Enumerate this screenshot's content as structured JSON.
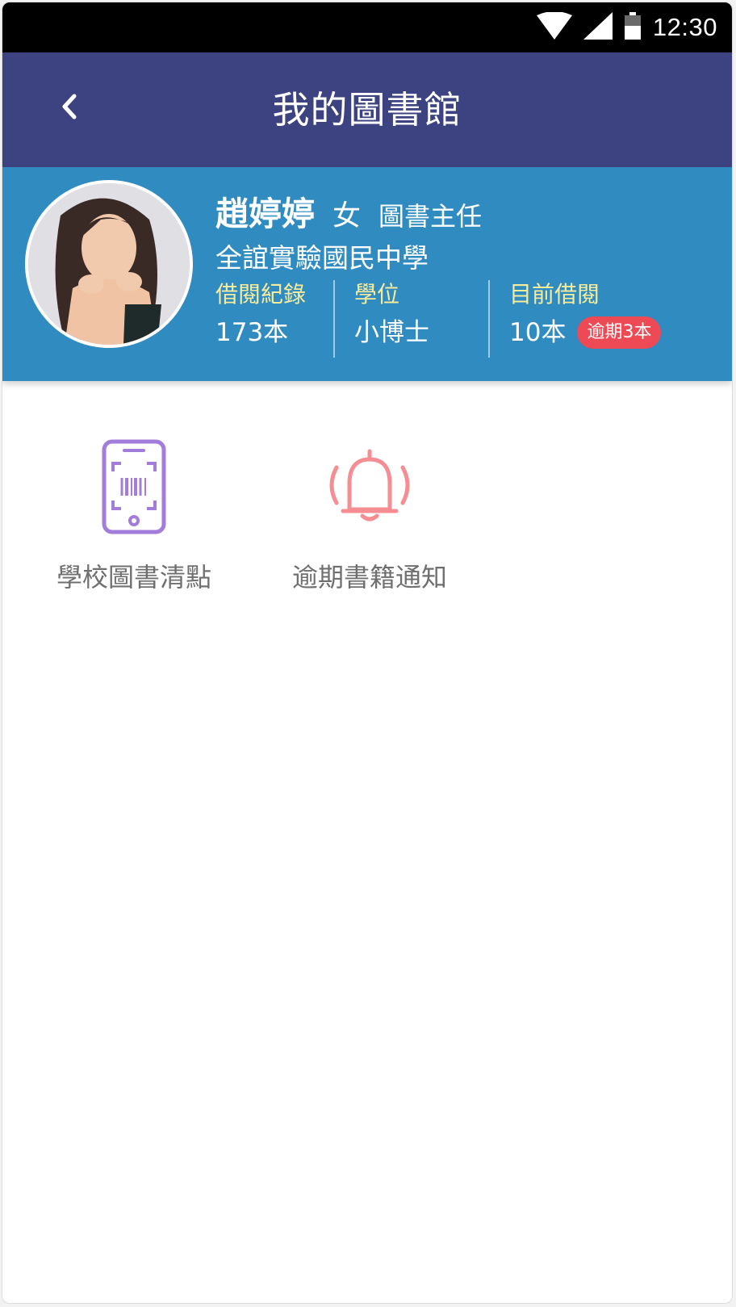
{
  "status_bar": {
    "time": "12:30",
    "icons": [
      "wifi-icon",
      "signal-icon",
      "battery-icon"
    ]
  },
  "header": {
    "title": "我的圖書館",
    "back_icon": "chevron-left-icon"
  },
  "profile": {
    "name": "趙婷婷",
    "gender": "女",
    "role": "圖書主任",
    "school": "全誼實驗國民中學",
    "stats": [
      {
        "label": "借閱紀錄",
        "value": "173本"
      },
      {
        "label": "學位",
        "value": "小博士"
      },
      {
        "label": "目前借閱",
        "value": "10本",
        "badge": "逾期3本"
      }
    ]
  },
  "features": [
    {
      "label": "學校圖書清點",
      "icon": "barcode-phone-icon",
      "color": "#a37ddb"
    },
    {
      "label": "逾期書籍通知",
      "icon": "bell-icon",
      "color": "#f58d93"
    }
  ],
  "colors": {
    "app_bar": "#3c4380",
    "profile_bg": "#2f8bc0",
    "stat_label": "#f6ec9c",
    "badge": "#ee4a55"
  }
}
